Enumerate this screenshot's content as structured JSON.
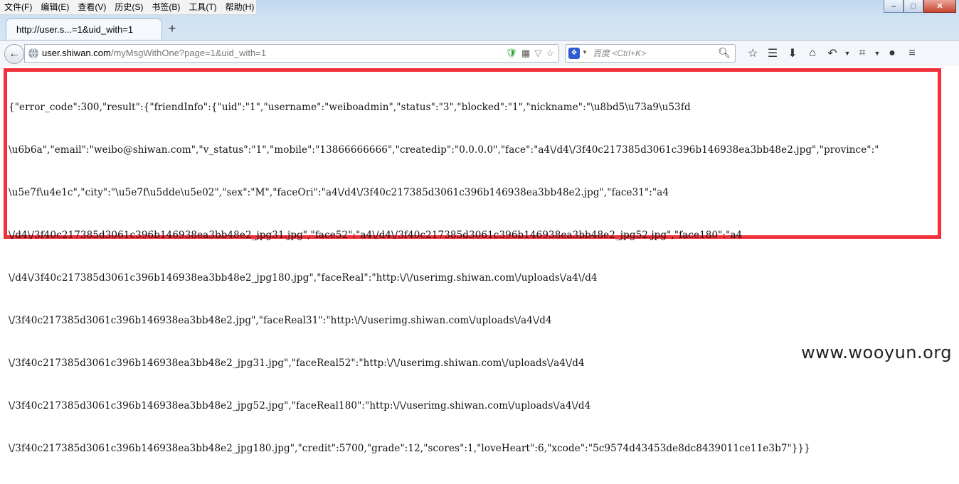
{
  "menu": {
    "items": [
      "文件(F)",
      "编辑(E)",
      "查看(V)",
      "历史(S)",
      "书签(B)",
      "工具(T)",
      "帮助(H)"
    ]
  },
  "window": {
    "minimize": "–",
    "maximize": "□",
    "close": "✕"
  },
  "tab": {
    "title": "http://user.s...=1&uid_with=1",
    "new_tab": "+"
  },
  "urlbar": {
    "host": "user.shiwan.com",
    "path": "/myMsgWithOne?page=1&uid_with=1"
  },
  "search": {
    "engine_icon": "paw-icon",
    "placeholder": "百度 <Ctrl+K>"
  },
  "page": {
    "json_lines": [
      "{\"error_code\":300,\"result\":{\"friendInfo\":{\"uid\":\"1\",\"username\":\"weiboadmin\",\"status\":\"3\",\"blocked\":\"1\",\"nickname\":\"\\u8bd5\\u73a9\\u53fd",
      "\\u6b6a\",\"email\":\"weibo@shiwan.com\",\"v_status\":\"1\",\"mobile\":\"13866666666\",\"createdip\":\"0.0.0.0\",\"face\":\"a4\\/d4\\/3f40c217385d3061c396b146938ea3bb48e2.jpg\",\"province\":\"",
      "\\u5e7f\\u4e1c\",\"city\":\"\\u5e7f\\u5dde\\u5e02\",\"sex\":\"M\",\"faceOri\":\"a4\\/d4\\/3f40c217385d3061c396b146938ea3bb48e2.jpg\",\"face31\":\"a4",
      "\\/d4\\/3f40c217385d3061c396b146938ea3bb48e2_jpg31.jpg\",\"face52\":\"a4\\/d4\\/3f40c217385d3061c396b146938ea3bb48e2_jpg52.jpg\",\"face180\":\"a4",
      "\\/d4\\/3f40c217385d3061c396b146938ea3bb48e2_jpg180.jpg\",\"faceReal\":\"http:\\/\\/userimg.shiwan.com\\/uploads\\/a4\\/d4",
      "\\/3f40c217385d3061c396b146938ea3bb48e2.jpg\",\"faceReal31\":\"http:\\/\\/userimg.shiwan.com\\/uploads\\/a4\\/d4",
      "\\/3f40c217385d3061c396b146938ea3bb48e2_jpg31.jpg\",\"faceReal52\":\"http:\\/\\/userimg.shiwan.com\\/uploads\\/a4\\/d4",
      "\\/3f40c217385d3061c396b146938ea3bb48e2_jpg52.jpg\",\"faceReal180\":\"http:\\/\\/userimg.shiwan.com\\/uploads\\/a4\\/d4",
      "\\/3f40c217385d3061c396b146938ea3bb48e2_jpg180.jpg\",\"credit\":5700,\"grade\":12,\"scores\":1,\"loveHeart\":6,\"xcode\":\"5c9574d43453de8dc8439011ce11e3b7\"}}}"
    ],
    "highlight_color": "#f0303a"
  },
  "watermark": "www.wooyun.org"
}
